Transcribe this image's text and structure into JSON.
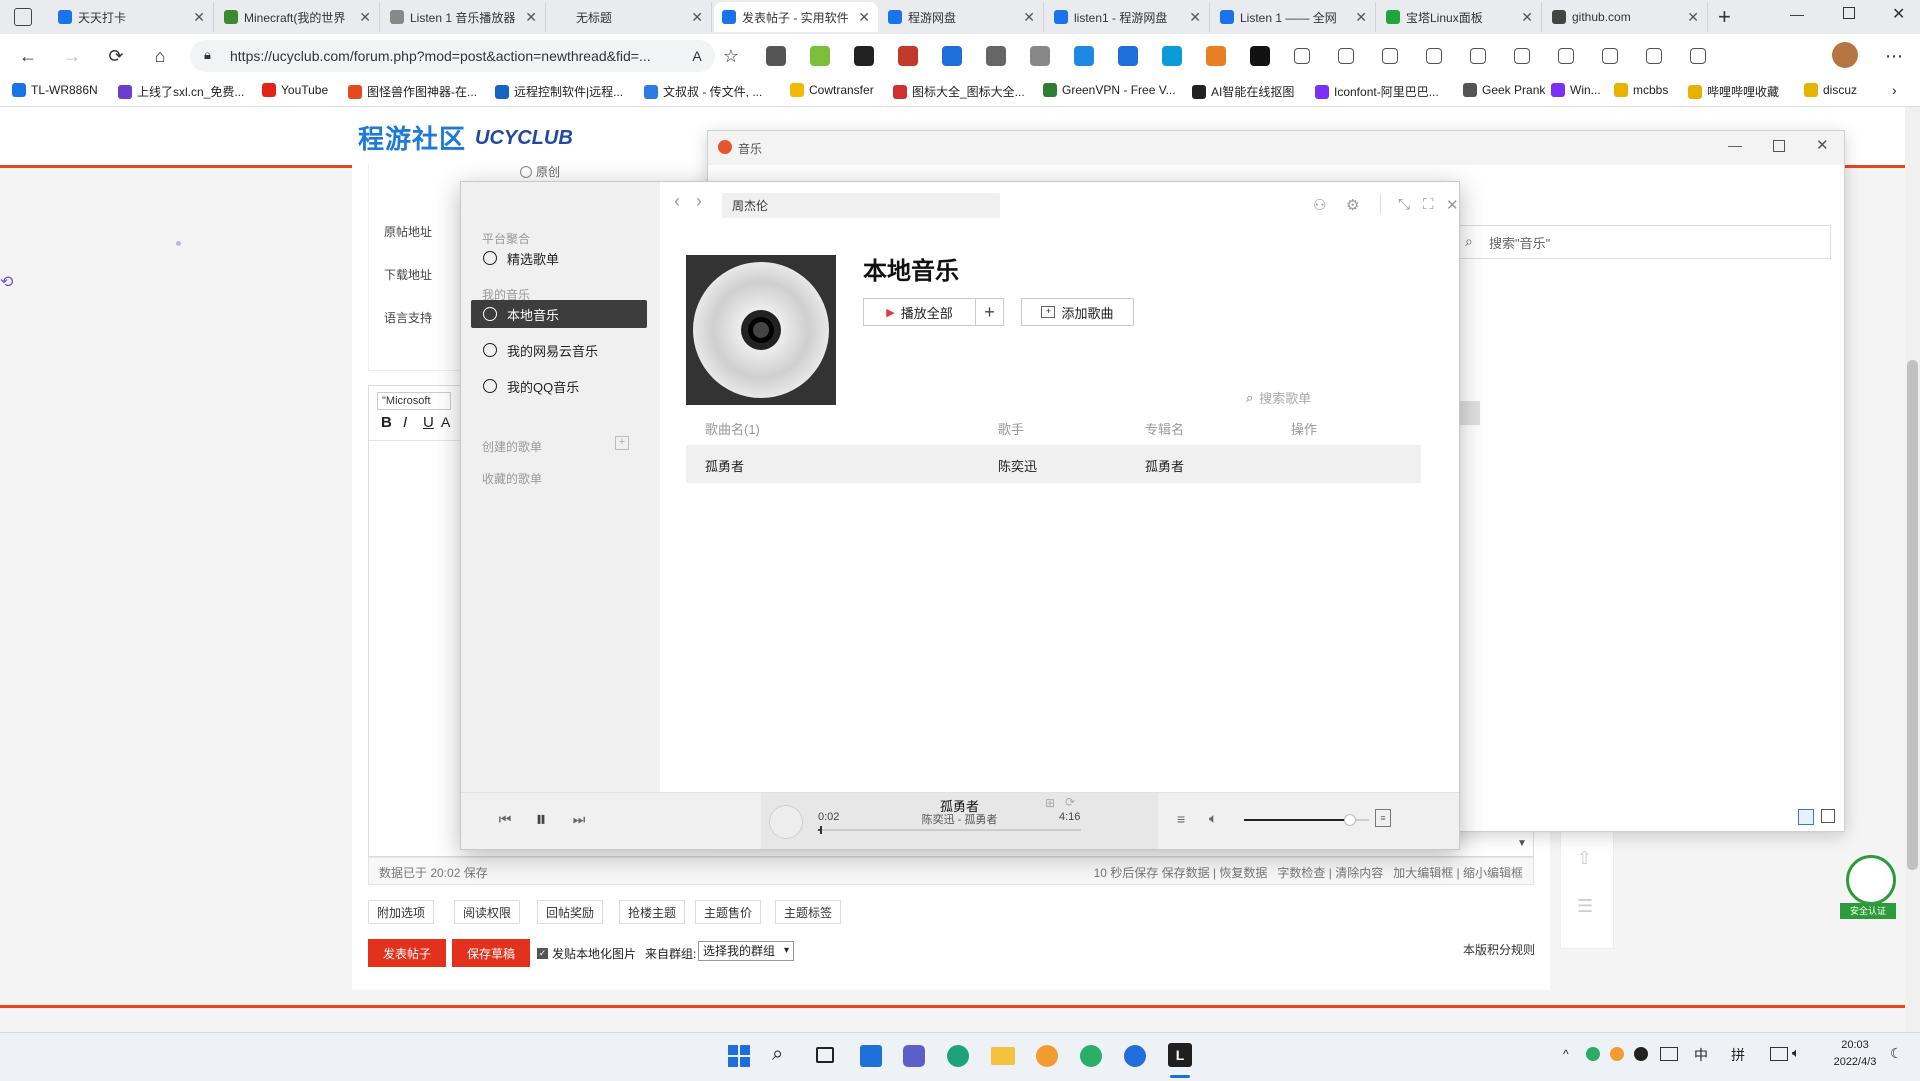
{
  "browser": {
    "tabs": [
      {
        "title": "天天打卡",
        "color": "#1a73e8",
        "icon": "ucy"
      },
      {
        "title": "Minecraft(我的世界",
        "color": "#3c8a2e",
        "icon": "mc"
      },
      {
        "title": "Listen 1 音乐播放器",
        "color": "#888888",
        "icon": "doc"
      },
      {
        "title": "无标题",
        "color": "#888888",
        "icon": "none"
      },
      {
        "title": "发表帖子 - 实用软件",
        "color": "#1a73e8",
        "icon": "ucy",
        "active": true
      },
      {
        "title": "程游网盘",
        "color": "#1a73e8",
        "icon": "cloud"
      },
      {
        "title": "listen1 - 程游网盘",
        "color": "#1a73e8",
        "icon": "cloud"
      },
      {
        "title": "Listen 1 —— 全网",
        "color": "#1a73e8",
        "icon": "tv"
      },
      {
        "title": "宝塔Linux面板",
        "color": "#20a53a",
        "icon": "bt"
      },
      {
        "title": "github.com",
        "color": "#444444",
        "icon": "gh"
      }
    ],
    "url": "https://ucyclub.com/forum.php?mod=post&action=newthread&fid=...",
    "bookmarks": [
      {
        "label": "TL-WR886N",
        "color": "#1a73e8"
      },
      {
        "label": "上线了sxl.cn_免费...",
        "color": "#6a3fd0"
      },
      {
        "label": "YouTube",
        "color": "#e62117"
      },
      {
        "label": "图怪兽作图神器-在...",
        "color": "#e24a1c"
      },
      {
        "label": "远程控制软件|远程...",
        "color": "#1565c0"
      },
      {
        "label": "文叔叔 - 传文件, ...",
        "color": "#2d7be5"
      },
      {
        "label": "Cowtransfer",
        "color": "#f5b800"
      },
      {
        "label": "图标大全_图标大全...",
        "color": "#d32f2f"
      },
      {
        "label": "GreenVPN - Free V...",
        "color": "#2e7d32"
      },
      {
        "label": "AI智能在线抠图",
        "color": "#222222"
      },
      {
        "label": "Iconfont-阿里巴巴...",
        "color": "#7b2ff7"
      },
      {
        "label": "Geek Prank",
        "color": "#555555"
      },
      {
        "label": "Win...",
        "color": "#7b2ff7"
      },
      {
        "label": "mcbbs",
        "color": "#e8b200"
      },
      {
        "label": "哔哩哔哩收藏",
        "color": "#e8b200"
      },
      {
        "label": "discuz",
        "color": "#e8b200"
      }
    ]
  },
  "site": {
    "logo": "程游社区",
    "logo_en": "UCYCLUB",
    "form_labels": [
      "原帖地址",
      "下载地址",
      "语言支持"
    ],
    "radio_label": "原创",
    "font_select": "\"Microsoft",
    "status_left": "数据已于 20:02 保存",
    "status_right": "10 秒后保存 保存数据 | 恢复数据   字数检查 | 清除内容   加大编辑框 | 缩小编辑框",
    "options": [
      "附加选项",
      "阅读权限",
      "回帖奖励",
      "抢楼主题",
      "主题售价",
      "主题标签"
    ],
    "publish_button": "发表帖子",
    "draft_button": "保存草稿",
    "local_image_checkbox": "发贴本地化图片",
    "group_label": "来自群组:",
    "group_select": "选择我的群组",
    "rules_link": "本版积分规则",
    "badge": "安全认证"
  },
  "bgwin": {
    "title": "音乐",
    "search_placeholder": "搜索\"音乐\""
  },
  "player": {
    "search_value": "周杰伦",
    "sidebar": {
      "section_platform": "平台聚合",
      "featured": "精选歌单",
      "section_my": "我的音乐",
      "local": "本地音乐",
      "netease": "我的网易云音乐",
      "qq": "我的QQ音乐",
      "created": "创建的歌单",
      "favorited": "收藏的歌单"
    },
    "page_title": "本地音乐",
    "play_all": "播放全部",
    "add_song": "添加歌曲",
    "search_songs": "搜索歌单",
    "columns": [
      "歌曲名(1)",
      "歌手",
      "专辑名",
      "操作"
    ],
    "songs": [
      {
        "name": "孤勇者",
        "artist": "陈奕迅",
        "album": "孤勇者"
      }
    ],
    "now_playing": {
      "title": "孤勇者",
      "subtitle": "陈奕迅 - 孤勇者",
      "elapsed": "0:02",
      "duration": "4:16",
      "progress": 0.008,
      "volume": 0.85
    }
  },
  "taskbar": {
    "time": "20:03",
    "date": "2022/4/3",
    "ime1": "中",
    "ime2": "拼"
  }
}
